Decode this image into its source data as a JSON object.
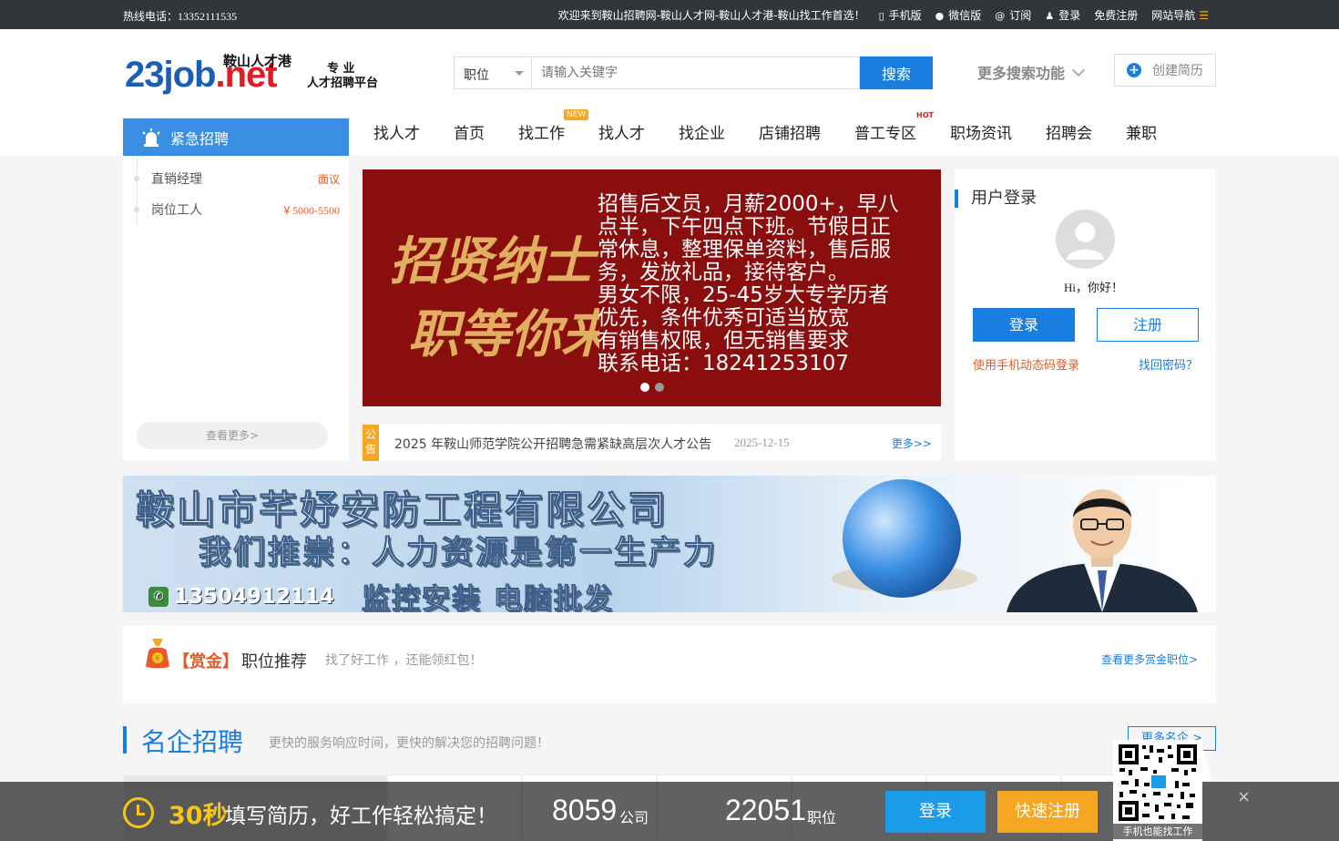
{
  "topbar": {
    "hotline": "热线电话：13352111535",
    "welcome": "欢迎来到鞍山招聘网-鞍山人才网-鞍山人才港-鞍山找工作首选！",
    "links": [
      "手机版",
      "微信版",
      "订阅",
      "登录",
      "免费注册",
      "网站导航"
    ]
  },
  "logo": {
    "domain_main": "23job",
    "domain_ext": ".net",
    "name": "鞍山人才港",
    "tag1": "专 业",
    "tag2": "人才招聘平台"
  },
  "search": {
    "category": "职位",
    "placeholder": "请输入关键字",
    "button": "搜索",
    "more": "更多搜索功能",
    "create_resume": "创建简历"
  },
  "urgent": {
    "tab": "紧急招聘",
    "items": [
      {
        "title": "直销经理",
        "salary": "面议"
      },
      {
        "title": "岗位工人",
        "salary": "￥5000-5500"
      }
    ],
    "more": "查看更多>"
  },
  "nav": {
    "items": [
      "找人才",
      "首页",
      "找工作",
      "找人才",
      "找企业",
      "店铺招聘",
      "普工专区",
      "职场资讯",
      "招聘会",
      "兼职"
    ],
    "badge_new": "NEW",
    "badge_hot": "HOT"
  },
  "banner": {
    "calligraphy": "招贤纳士 职等你来",
    "lines": [
      "招售后文员，月薪2000+，早八",
      "点半，下午四点下班。节假日正",
      "常休息，整理保单资料，售后服",
      "务，发放礼品，接待客户。",
      "男女不限，25-45岁大专学历者",
      "优先，条件优秀可适当放宽",
      "有销售权限，但无销售要求",
      "联系电话：18241253107"
    ]
  },
  "notice": {
    "tag": "公告",
    "title": "2025 年鞍山师范学院公开招聘急需紧缺高层次人才公告",
    "date": "2025-12-15",
    "more": "更多>>"
  },
  "login": {
    "title": "用户登录",
    "greeting": "Hi，你好！",
    "login_button": "登录",
    "register_button": "注册",
    "sms_login": "使用手机动态码登录",
    "forgot": "找回密码？"
  },
  "ad": {
    "company": "鞍山市芊妤安防工程有限公司",
    "slogan": "我们推崇：人力资源是第一生产力",
    "business": "监控安装  电脑批发",
    "phone": "13504912114"
  },
  "reward": {
    "tag": "【赏金】",
    "title": "职位推荐",
    "desc": "找了好工作 ，还能领红包！",
    "more": "查看更多赏金职位>"
  },
  "famous": {
    "title": "名企招聘",
    "desc": "更快的服务响应时间，更快的解决您的招聘问题！",
    "more": "更多名企 >"
  },
  "sticky": {
    "seconds": "30秒",
    "slogan": "填写简历，好工作轻松搞定！",
    "companies": "8059",
    "companies_unit": "公司",
    "jobs": "22051",
    "jobs_unit": "职位",
    "login": "登录",
    "register": "快速注册",
    "close": "×",
    "qr_caption": "手机也能找工作"
  },
  "colors": {
    "primary": "#1a7ee0",
    "accent": "#f5a623",
    "topbar": "#333639",
    "banner_bg": "#8a0e0e"
  }
}
